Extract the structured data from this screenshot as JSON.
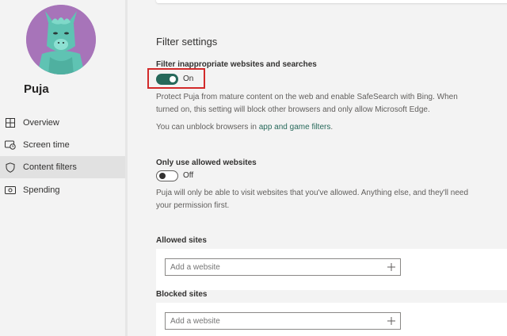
{
  "profile": {
    "name": "Puja"
  },
  "nav": {
    "items": [
      {
        "label": "Overview",
        "icon": "overview-grid-icon"
      },
      {
        "label": "Screen time",
        "icon": "screen-time-icon"
      },
      {
        "label": "Content filters",
        "icon": "shield-icon",
        "active": true
      },
      {
        "label": "Spending",
        "icon": "spending-icon"
      }
    ]
  },
  "page": {
    "title": "Filter settings"
  },
  "filter_web": {
    "title": "Filter inappropriate websites and searches",
    "state": "On",
    "description": "Protect Puja from mature content on the web and enable SafeSearch with Bing. When turned on, this setting will block other browsers and only allow Microsoft Edge.",
    "unblock_prefix": "You can unblock browsers in ",
    "unblock_link": "app and game filters",
    "unblock_suffix": "."
  },
  "allowed_only": {
    "title": "Only use allowed websites",
    "state": "Off",
    "description": "Puja will only be able to visit websites that you've allowed. Anything else, and they'll need your permission first."
  },
  "allowed_sites": {
    "label": "Allowed sites",
    "placeholder": "Add a website"
  },
  "blocked_sites": {
    "label": "Blocked sites",
    "placeholder": "Add a website"
  },
  "colors": {
    "accent": "#27695b",
    "highlight": "#d22a2a",
    "avatar_bg": "#a774b9",
    "llama": "#5fc3b3"
  }
}
